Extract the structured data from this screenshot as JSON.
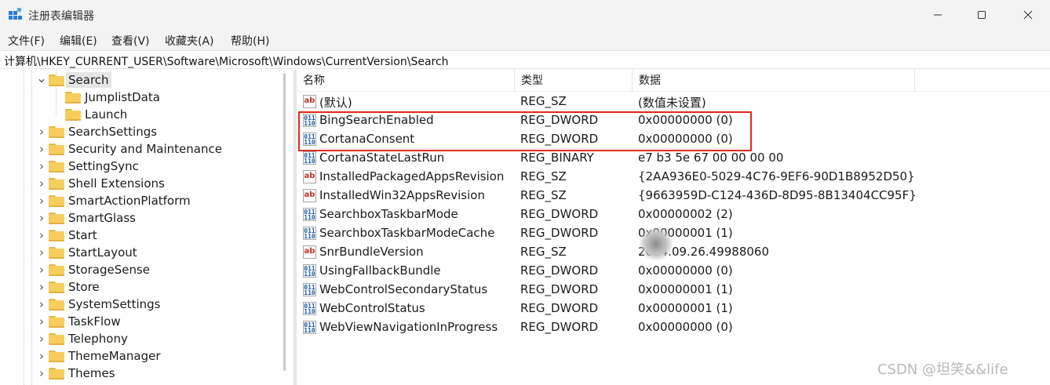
{
  "window": {
    "title": "注册表编辑器"
  },
  "menu": [
    "文件(F)",
    "编辑(E)",
    "查看(V)",
    "收藏夹(A)",
    "帮助(H)"
  ],
  "address": "计算机\\HKEY_CURRENT_USER\\Software\\Microsoft\\Windows\\CurrentVersion\\Search",
  "tree": {
    "items": [
      {
        "label": "Search",
        "expanded": true,
        "selected": true
      },
      {
        "label": "JumplistData",
        "child": true
      },
      {
        "label": "Launch",
        "child": true
      },
      {
        "label": "SearchSettings"
      },
      {
        "label": "Security and Maintenance"
      },
      {
        "label": "SettingSync"
      },
      {
        "label": "Shell Extensions"
      },
      {
        "label": "SmartActionPlatform"
      },
      {
        "label": "SmartGlass"
      },
      {
        "label": "Start"
      },
      {
        "label": "StartLayout"
      },
      {
        "label": "StorageSense"
      },
      {
        "label": "Store"
      },
      {
        "label": "SystemSettings"
      },
      {
        "label": "TaskFlow"
      },
      {
        "label": "Telephony"
      },
      {
        "label": "ThemeManager"
      },
      {
        "label": "Themes"
      }
    ]
  },
  "values": {
    "columns": [
      "名称",
      "类型",
      "数据"
    ],
    "rows": [
      {
        "icon": "string-value-icon",
        "name": "(默认)",
        "type": "REG_SZ",
        "data": "(数值未设置)"
      },
      {
        "icon": "binary-value-icon",
        "name": "BingSearchEnabled",
        "type": "REG_DWORD",
        "data": "0x00000000 (0)"
      },
      {
        "icon": "binary-value-icon",
        "name": "CortanaConsent",
        "type": "REG_DWORD",
        "data": "0x00000000 (0)"
      },
      {
        "icon": "binary-value-icon",
        "name": "CortanaStateLastRun",
        "type": "REG_BINARY",
        "data": "e7 b3 5e 67 00 00 00 00"
      },
      {
        "icon": "string-value-icon",
        "name": "InstalledPackagedAppsRevision",
        "type": "REG_SZ",
        "data": "{2AA936E0-5029-4C76-9EF6-90D1B8952D50}"
      },
      {
        "icon": "string-value-icon",
        "name": "InstalledWin32AppsRevision",
        "type": "REG_SZ",
        "data": "{9663959D-C124-436D-8D95-8B13404CC95F}"
      },
      {
        "icon": "binary-value-icon",
        "name": "SearchboxTaskbarMode",
        "type": "REG_DWORD",
        "data": "0x00000002 (2)"
      },
      {
        "icon": "binary-value-icon",
        "name": "SearchboxTaskbarModeCache",
        "type": "REG_DWORD",
        "data": "0x00000001 (1)"
      },
      {
        "icon": "string-value-icon",
        "name": "SnrBundleVersion",
        "type": "REG_SZ",
        "data": "2024.09.26.49988060"
      },
      {
        "icon": "binary-value-icon",
        "name": "UsingFallbackBundle",
        "type": "REG_DWORD",
        "data": "0x00000000 (0)"
      },
      {
        "icon": "binary-value-icon",
        "name": "WebControlSecondaryStatus",
        "type": "REG_DWORD",
        "data": "0x00000001 (1)"
      },
      {
        "icon": "binary-value-icon",
        "name": "WebControlStatus",
        "type": "REG_DWORD",
        "data": "0x00000001 (1)"
      },
      {
        "icon": "binary-value-icon",
        "name": "WebViewNavigationInProgress",
        "type": "REG_DWORD",
        "data": "0x00000000 (0)"
      }
    ]
  },
  "icon_glyphs": {
    "string": "ab",
    "binary": "011\n110"
  },
  "colors": {
    "highlight": "#e0291c",
    "folder": "#f7cd5c",
    "selection": "#e5e5e5"
  },
  "watermark": "CSDN @坦笑&&life"
}
